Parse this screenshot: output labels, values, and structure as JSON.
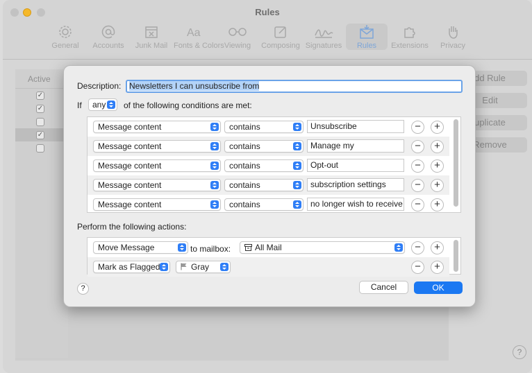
{
  "window": {
    "title": "Rules"
  },
  "toolbar": {
    "items": [
      {
        "label": "General",
        "icon": "gear-icon"
      },
      {
        "label": "Accounts",
        "icon": "at-icon"
      },
      {
        "label": "Junk Mail",
        "icon": "junk-mail-icon"
      },
      {
        "label": "Fonts & Colors",
        "icon": "fonts-icon"
      },
      {
        "label": "Viewing",
        "icon": "glasses-icon"
      },
      {
        "label": "Composing",
        "icon": "compose-icon"
      },
      {
        "label": "Signatures",
        "icon": "signature-icon"
      },
      {
        "label": "Rules",
        "icon": "rules-icon",
        "active": true
      },
      {
        "label": "Extensions",
        "icon": "puzzle-icon"
      },
      {
        "label": "Privacy",
        "icon": "hand-icon"
      }
    ]
  },
  "rules_list": {
    "header": "Active"
  },
  "side_buttons": {
    "add": "dd Rule",
    "edit": "Edit",
    "duplicate": "uplicate",
    "remove": "Remove"
  },
  "sheet": {
    "description_label": "Description:",
    "description_value": "Newsletters I can unsubscribe from",
    "if_label": "If",
    "match_mode": "any",
    "conditions_suffix": "of the following conditions are met:",
    "conditions": [
      {
        "field": "Message content",
        "operator": "contains",
        "value": "Unsubscribe"
      },
      {
        "field": "Message content",
        "operator": "contains",
        "value": "Manage my"
      },
      {
        "field": "Message content",
        "operator": "contains",
        "value": "Opt-out"
      },
      {
        "field": "Message content",
        "operator": "contains",
        "value": "subscription settings"
      },
      {
        "field": "Message content",
        "operator": "contains",
        "value": "no longer wish to receive"
      }
    ],
    "actions_label": "Perform the following actions:",
    "actions": [
      {
        "action": "Move Message",
        "connector": "to mailbox:",
        "target": "All Mail"
      },
      {
        "action": "Mark as Flagged",
        "target": "Gray"
      }
    ],
    "help": "?",
    "cancel": "Cancel",
    "ok": "OK"
  },
  "colors": {
    "accent": "#1b78f2",
    "highlight": "#b3d3f8"
  }
}
